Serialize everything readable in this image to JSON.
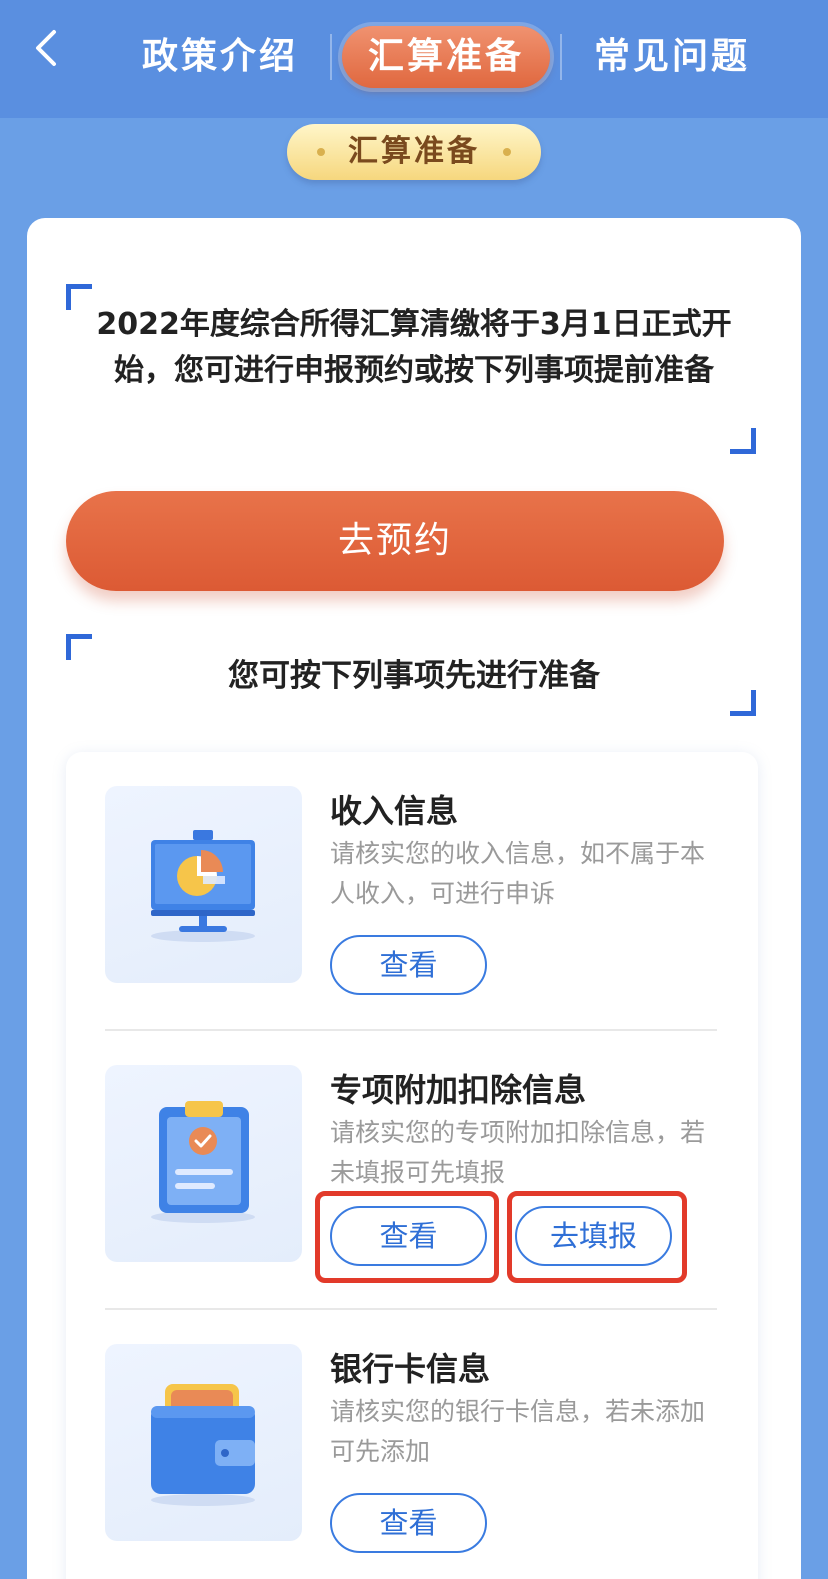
{
  "nav": {
    "back_icon": "chevron-left-icon",
    "tabs": [
      {
        "label": "政策介绍",
        "active": false
      },
      {
        "label": "汇算准备",
        "active": true
      },
      {
        "label": "常见问题",
        "active": false
      }
    ]
  },
  "section_title": "汇算准备",
  "intro": {
    "text": "2022年度综合所得汇算清缴将于3月1日正式开始，您可进行申报预约或按下列事项提前准备"
  },
  "reserve_button": {
    "label": "去预约"
  },
  "prep_heading": "您可按下列事项先进行准备",
  "items": [
    {
      "title": "收入信息",
      "description": "请核实您的收入信息，如不属于本人收入，可进行申诉",
      "icon": "presentation-chart-icon",
      "buttons": [
        {
          "label": "查看",
          "highlighted": false
        }
      ]
    },
    {
      "title": "专项附加扣除信息",
      "description": "请核实您的专项附加扣除信息，若未填报可先填报",
      "icon": "clipboard-check-icon",
      "buttons": [
        {
          "label": "查看",
          "highlighted": true
        },
        {
          "label": "去填报",
          "highlighted": true
        }
      ]
    },
    {
      "title": "银行卡信息",
      "description": "请核实您的银行卡信息，若未添加可先添加",
      "icon": "wallet-icon",
      "buttons": [
        {
          "label": "查看",
          "highlighted": false
        }
      ]
    }
  ],
  "colors": {
    "background": "#6a9fe6",
    "nav": "#5a8fe0",
    "accent_orange": "#e0683f",
    "primary_blue": "#3a7be0",
    "highlight_red": "#e23a2a"
  }
}
